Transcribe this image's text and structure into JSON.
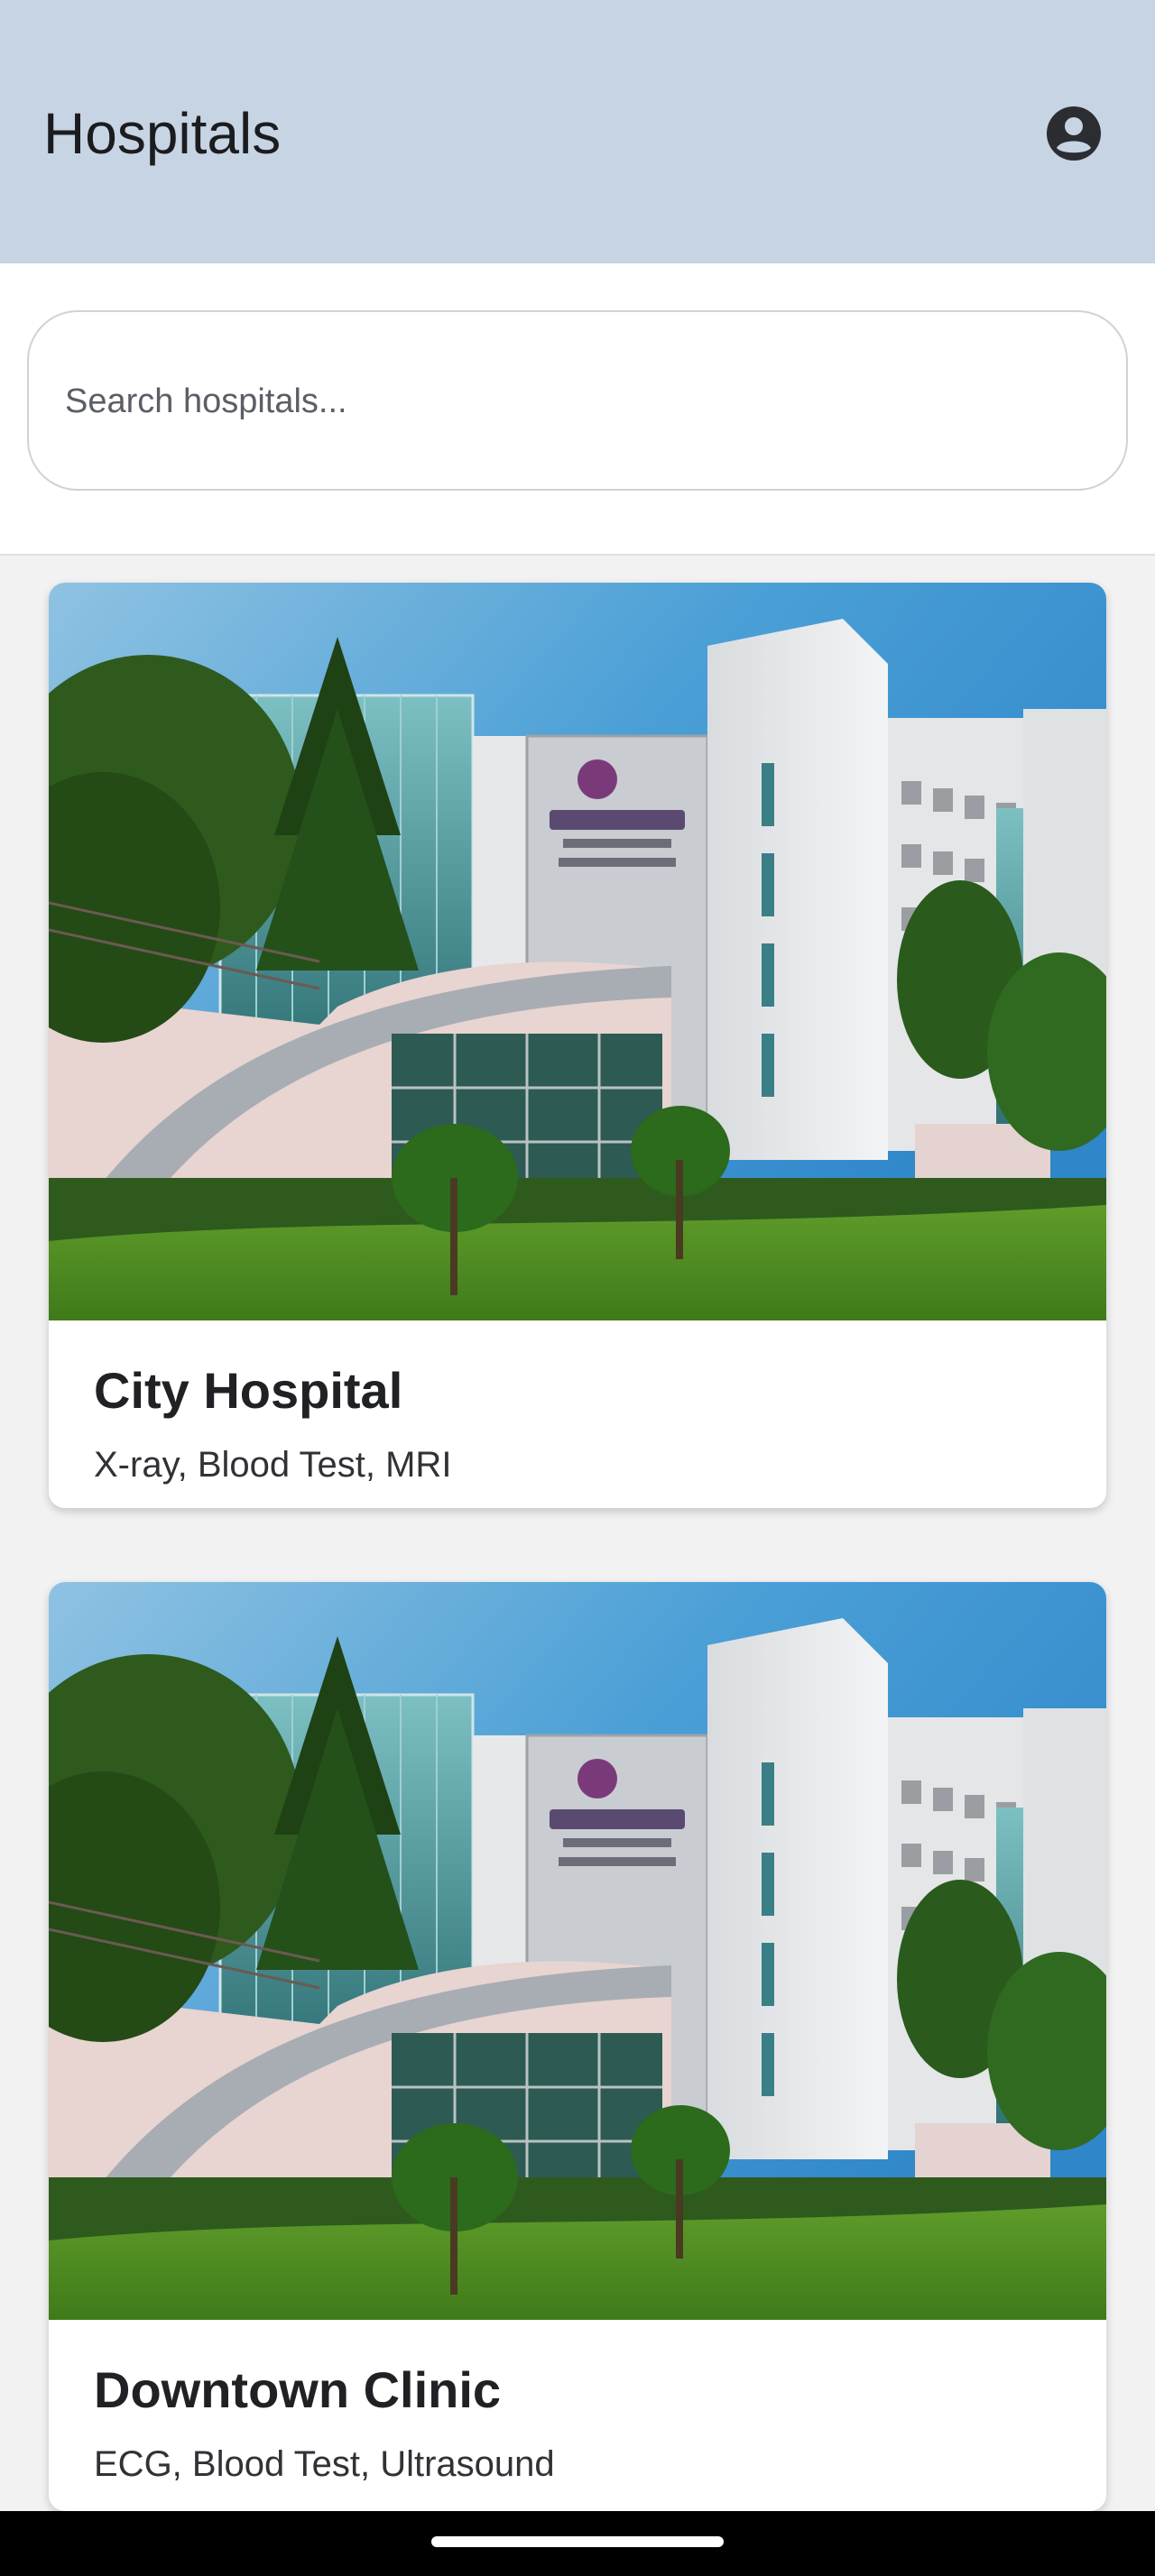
{
  "app_bar": {
    "title": "Hospitals",
    "account_icon": "account-circle-icon"
  },
  "search": {
    "placeholder": "Search hospitals...",
    "value": ""
  },
  "hospitals": [
    {
      "name": "City Hospital",
      "services": "X-ray, Blood Test, MRI",
      "image": "hospital-building-photo"
    },
    {
      "name": "Downtown Clinic",
      "services": "ECG, Blood Test, Ultrasound",
      "image": "hospital-building-photo"
    }
  ],
  "colors": {
    "app_bar_bg": "#c6d4e4",
    "page_bg": "#f2f2f2",
    "card_bg": "#ffffff",
    "nav_bar_bg": "#000000"
  }
}
